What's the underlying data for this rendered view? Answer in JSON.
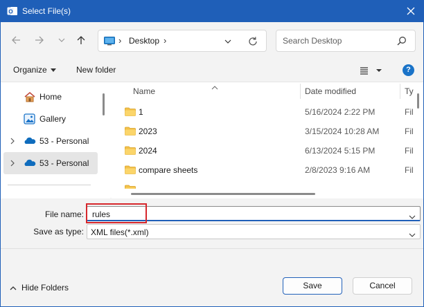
{
  "window": {
    "title": "Select File(s)"
  },
  "address": {
    "separator": "›",
    "location": "Desktop",
    "end_separator": "›"
  },
  "search": {
    "placeholder": "Search Desktop"
  },
  "toolbar": {
    "organize_label": "Organize",
    "new_folder_label": "New folder",
    "help_label": "?"
  },
  "nav_items": [
    {
      "label": "Home",
      "icon": "home-icon",
      "expandable": false,
      "selected": false
    },
    {
      "label": "Gallery",
      "icon": "gallery-icon",
      "expandable": false,
      "selected": false
    },
    {
      "label": "53 - Personal",
      "icon": "onedrive-icon",
      "expandable": true,
      "selected": false
    },
    {
      "label": "53 - Personal",
      "icon": "onedrive-icon",
      "expandable": true,
      "selected": true
    }
  ],
  "columns": {
    "name": "Name",
    "date_modified": "Date modified",
    "type": "Ty"
  },
  "files": [
    {
      "name": "1",
      "date": "5/16/2024 2:22 PM",
      "type": "Fil"
    },
    {
      "name": "2023",
      "date": "3/15/2024 10:28 AM",
      "type": "Fil"
    },
    {
      "name": "2024",
      "date": "6/13/2024 5:15 PM",
      "type": "Fil"
    },
    {
      "name": "compare sheets",
      "date": "2/8/2023 9:16 AM",
      "type": "Fil"
    }
  ],
  "file_name": {
    "label": "File name:",
    "value": "rules"
  },
  "save_as_type": {
    "label": "Save as type:",
    "value": "XML files(*.xml)"
  },
  "footer": {
    "hide_folders_label": "Hide Folders",
    "save_label": "Save",
    "cancel_label": "Cancel"
  },
  "colors": {
    "accent": "#1f5fb8",
    "highlight": "#d6262b",
    "folder": "#f3c14b"
  }
}
